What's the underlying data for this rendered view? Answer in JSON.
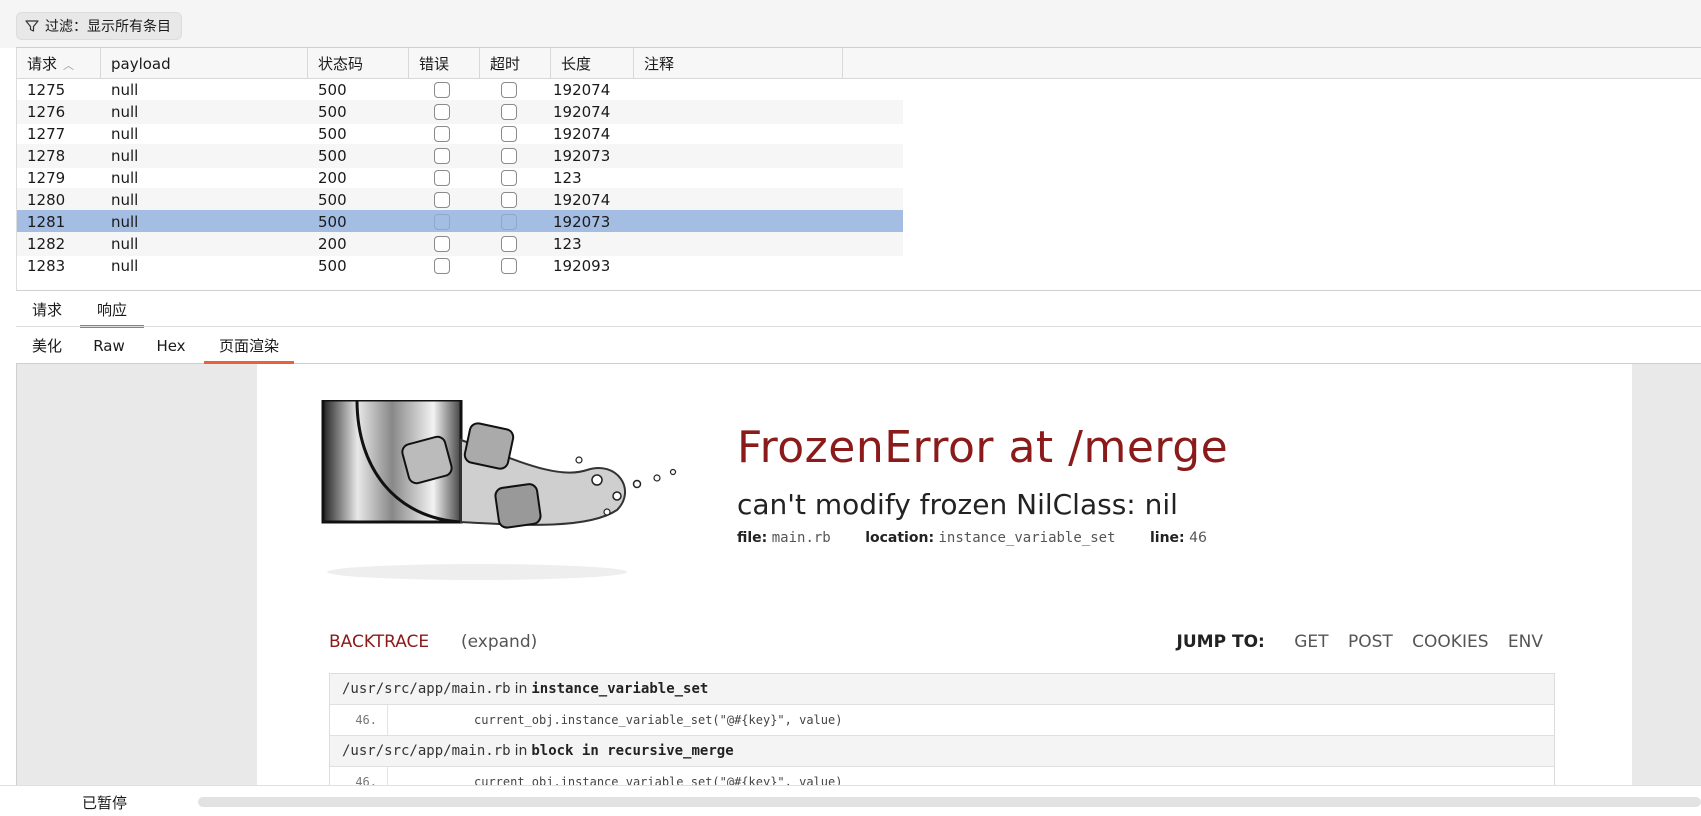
{
  "filter": {
    "label": "过滤：显示所有条目"
  },
  "table": {
    "columns": [
      "请求",
      "payload",
      "状态码",
      "错误",
      "超时",
      "长度",
      "注释"
    ],
    "rows": [
      {
        "request": "1275",
        "payload": "null",
        "status": "500",
        "length": "192074",
        "comment": ""
      },
      {
        "request": "1276",
        "payload": "null",
        "status": "500",
        "length": "192074",
        "comment": ""
      },
      {
        "request": "1277",
        "payload": "null",
        "status": "500",
        "length": "192074",
        "comment": ""
      },
      {
        "request": "1278",
        "payload": "null",
        "status": "500",
        "length": "192073",
        "comment": ""
      },
      {
        "request": "1279",
        "payload": "null",
        "status": "200",
        "length": "123",
        "comment": ""
      },
      {
        "request": "1280",
        "payload": "null",
        "status": "500",
        "length": "192074",
        "comment": ""
      },
      {
        "request": "1281",
        "payload": "null",
        "status": "500",
        "length": "192073",
        "comment": ""
      },
      {
        "request": "1282",
        "payload": "null",
        "status": "200",
        "length": "123",
        "comment": ""
      },
      {
        "request": "1283",
        "payload": "null",
        "status": "500",
        "length": "192093",
        "comment": ""
      }
    ],
    "selected_request": "1281"
  },
  "tabs_primary": [
    "请求",
    "响应"
  ],
  "tabs_primary_active": "响应",
  "tabs_secondary": [
    "美化",
    "Raw",
    "Hex",
    "页面渲染"
  ],
  "tabs_secondary_active": "页面渲染",
  "render": {
    "error_title": "FrozenError at /merge",
    "error_message": "can't modify frozen NilClass: nil",
    "file_label": "file:",
    "file_value": "main.rb",
    "location_label": "location:",
    "location_value": "instance_variable_set",
    "line_label": "line:",
    "line_value": "46",
    "backtrace_label": "BACKTRACE",
    "expand_label": "(expand)",
    "jump_to_label": "JUMP TO:",
    "jump_links": [
      "GET",
      "POST",
      "COOKIES",
      "ENV"
    ],
    "frames": [
      {
        "path": "/usr/src/app/main.rb",
        "in": "in",
        "function": "instance_variable_set",
        "line": "46.",
        "code": "current_obj.instance_variable_set(\"@#{key}\", value)"
      },
      {
        "path": "/usr/src/app/main.rb",
        "in": "in",
        "function": "block in recursive_merge",
        "line": "46.",
        "code": "current_obj.instance_variable_set(\"@#{key}\", value)"
      }
    ]
  },
  "status": {
    "text": "已暂停"
  },
  "colors": {
    "selected_row": "#a3bde3",
    "tab_underline": "#e8613a",
    "error_red": "#8b1a1a"
  }
}
